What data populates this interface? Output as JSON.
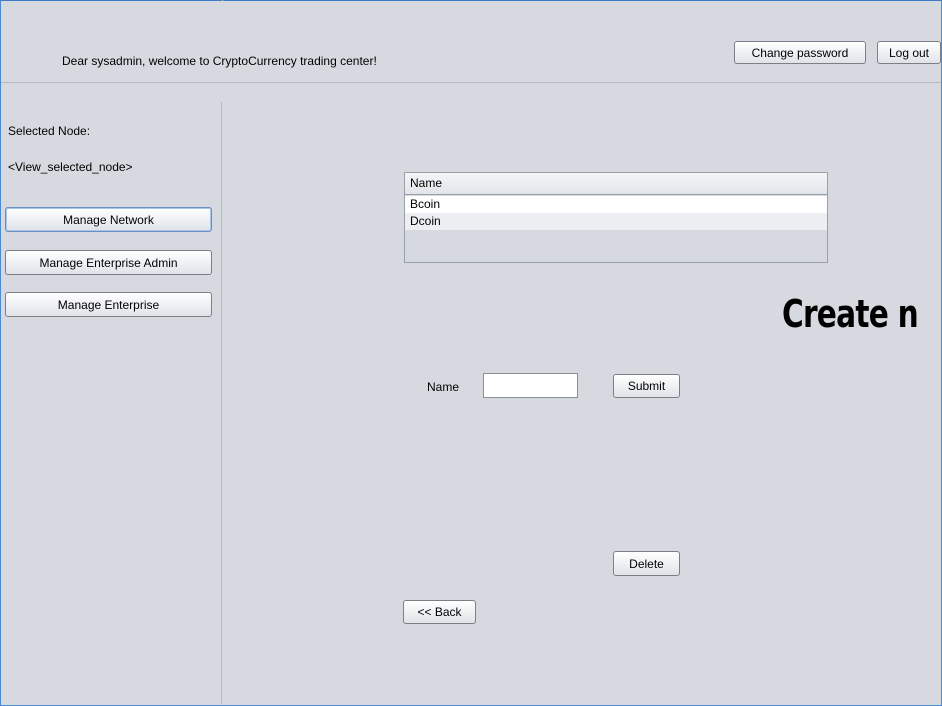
{
  "header": {
    "welcome_text": "Dear sysadmin, welcome to CryptoCurrency trading center!",
    "change_password_label": "Change password",
    "logout_label": "Log out"
  },
  "sidebar": {
    "selected_node_label": "Selected Node:",
    "selected_node_value": "<View_selected_node>",
    "buttons": [
      {
        "label": "Manage Network"
      },
      {
        "label": "Manage Enterprise Admin"
      },
      {
        "label": "Manage Enterprise"
      }
    ]
  },
  "main": {
    "table": {
      "column_header": "Name",
      "rows": [
        "Bcoin",
        "Dcoin"
      ]
    },
    "overlay_title": "Create n",
    "name_label": "Name",
    "name_input_value": "",
    "submit_label": "Submit",
    "delete_label": "Delete",
    "back_label": "<< Back"
  }
}
